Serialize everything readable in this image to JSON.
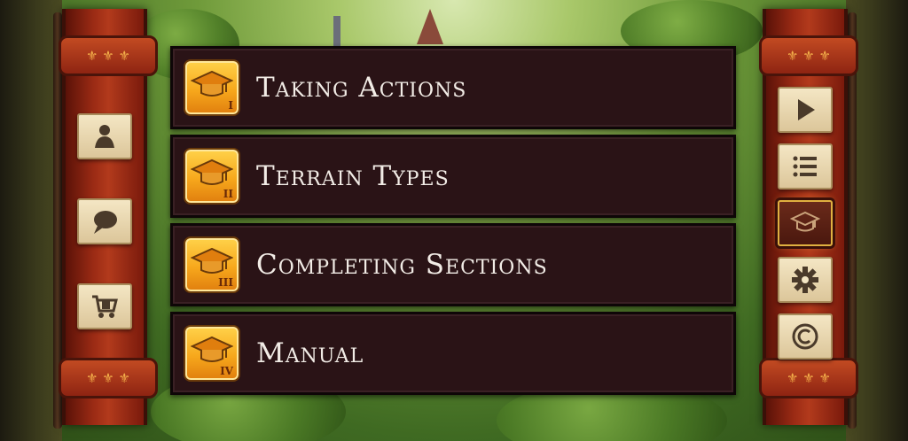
{
  "menu": {
    "items": [
      {
        "label": "Taking Actions",
        "badge": "I",
        "icon": "graduation-cap-icon"
      },
      {
        "label": "Terrain Types",
        "badge": "II",
        "icon": "graduation-cap-icon"
      },
      {
        "label": "Completing Sections",
        "badge": "III",
        "icon": "graduation-cap-icon"
      },
      {
        "label": "Manual",
        "badge": "IV",
        "icon": "graduation-cap-icon"
      }
    ]
  },
  "left_sidebar": {
    "buttons": [
      {
        "icon": "single-player-icon"
      },
      {
        "icon": "chat-bubble-icon"
      },
      {
        "icon": "shop-cart-icon"
      }
    ]
  },
  "right_sidebar": {
    "buttons": [
      {
        "icon": "play-icon"
      },
      {
        "icon": "list-icon"
      },
      {
        "icon": "graduation-cap-icon",
        "active": true
      },
      {
        "icon": "gear-icon"
      },
      {
        "icon": "copyright-icon"
      }
    ]
  },
  "colors": {
    "menu_bg": "#2a1316",
    "badge_gold": "#f7a81c",
    "banner_red": "#9a2a14",
    "tile_parchment": "#f4e6c4",
    "active_border": "#e0b040"
  }
}
